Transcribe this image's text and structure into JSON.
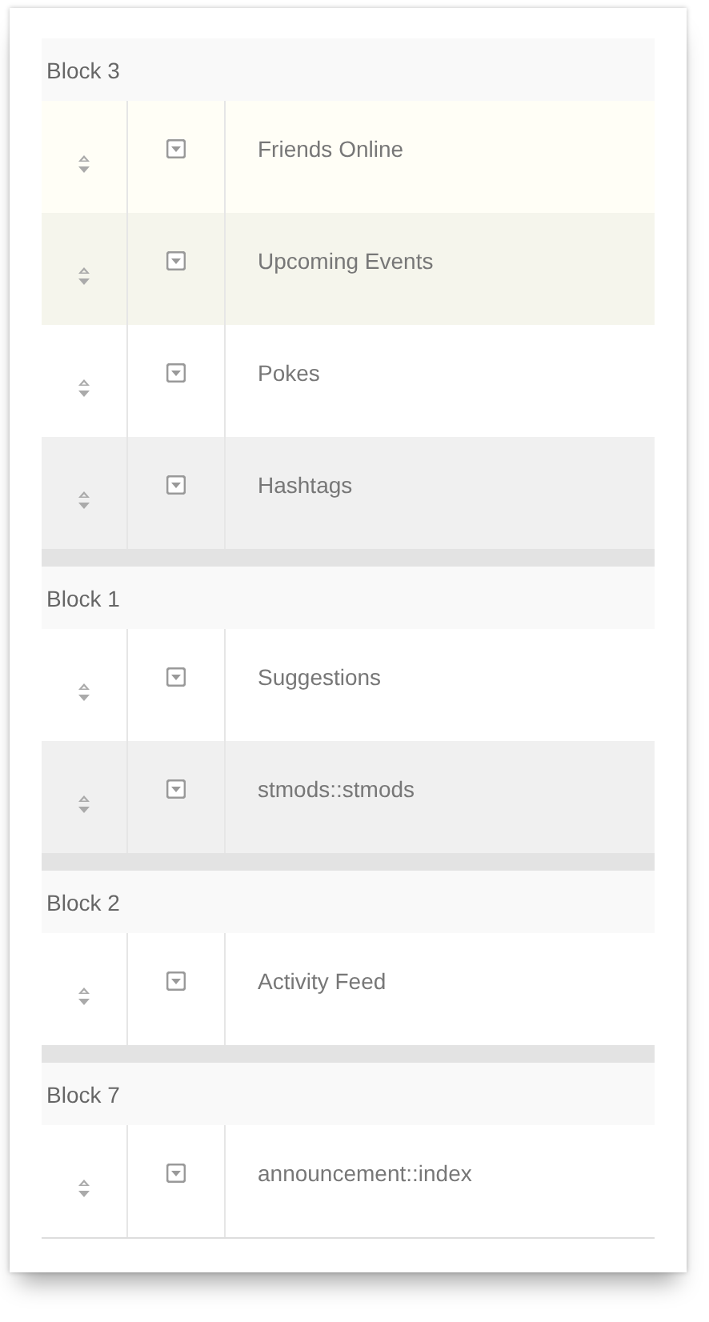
{
  "blocks": [
    {
      "title": "Block 3",
      "rows": [
        {
          "label": "Friends Online",
          "color": "#fffef6"
        },
        {
          "label": "Upcoming Events",
          "color": "#f5f5ec"
        },
        {
          "label": "Pokes",
          "color": "#ffffff"
        },
        {
          "label": "Hashtags",
          "color": "#f0f0f0"
        }
      ]
    },
    {
      "title": "Block 1",
      "rows": [
        {
          "label": "Suggestions",
          "color": "#ffffff"
        },
        {
          "label": "stmods::stmods",
          "color": "#f0f0f0"
        }
      ]
    },
    {
      "title": "Block 2",
      "rows": [
        {
          "label": "Activity Feed",
          "color": "#ffffff"
        }
      ]
    },
    {
      "title": "Block 7",
      "rows": [
        {
          "label": "announcement::index",
          "color": "#ffffff"
        }
      ]
    }
  ]
}
